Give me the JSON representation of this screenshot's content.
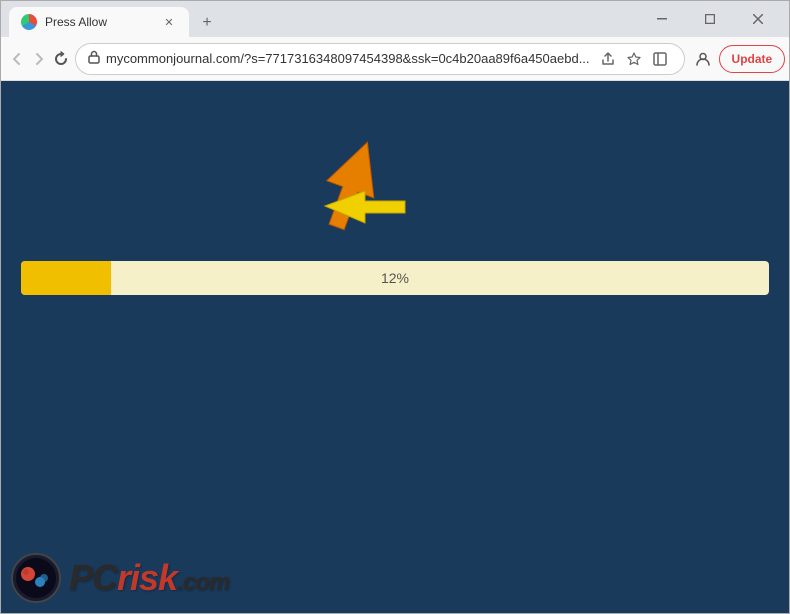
{
  "window": {
    "title": "Press Allow",
    "tab_title": "Press Allow"
  },
  "titlebar": {
    "minimize_label": "minimize",
    "maximize_label": "maximize",
    "close_label": "close",
    "new_tab_label": "+"
  },
  "toolbar": {
    "url": "mycommonjournal.com/?s=7717316348097454398&ssk=0c4b20aa89f6a450aebd...",
    "update_button": "Update"
  },
  "page": {
    "progress_percent": 12,
    "progress_label": "12%",
    "background_color": "#1a3a5c",
    "progress_bar_bg": "#f5f0c8",
    "progress_bar_fill": "#f0c000",
    "progress_fill_width": "12%"
  },
  "logo": {
    "text_pc": "PC",
    "text_risk": "risk",
    "domain": ".com"
  },
  "icons": {
    "back": "←",
    "forward": "→",
    "reload": "✕",
    "lock": "🔒",
    "share": "⬆",
    "bookmark": "☆",
    "sidebar": "▣",
    "profile": "👤",
    "menu": "⋮"
  }
}
